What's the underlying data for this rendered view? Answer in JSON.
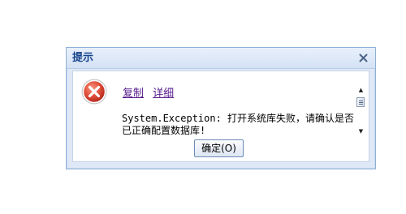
{
  "dialog": {
    "title": "提示",
    "close_icon": "close-icon",
    "error_icon": "error-icon",
    "links": {
      "copy": "复制",
      "details": "详细"
    },
    "message": "System.Exception: 打开系统库失败，请确认是否已正确配置数据库!",
    "ok_label": "确定(O)"
  },
  "colors": {
    "title_text": "#15428b",
    "frame": "#dfe8f6",
    "link": "#551a8b",
    "error_red": "#d9452d"
  }
}
